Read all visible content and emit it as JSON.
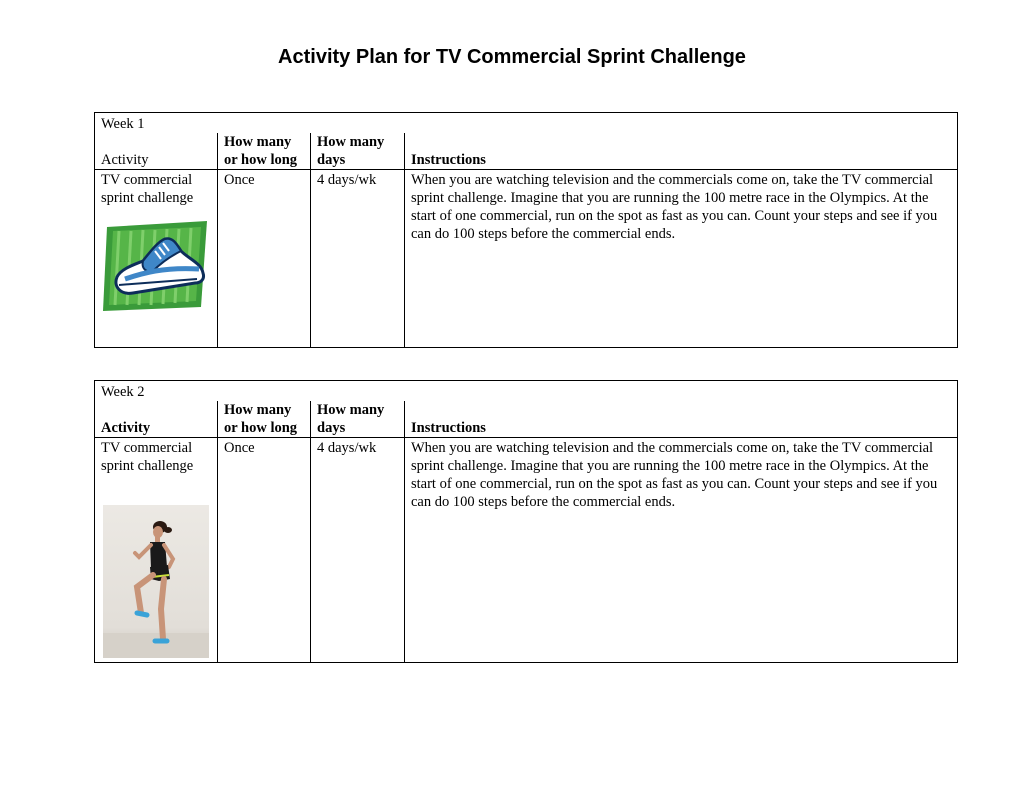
{
  "title": "Activity Plan for TV Commercial Sprint Challenge",
  "weeks": [
    {
      "label": "Week 1",
      "headers": {
        "activity": "Activity",
        "how_many_line1": "How many",
        "how_many_line2": "or how long",
        "days_line1": "How many",
        "days_line2": "days",
        "instructions": "Instructions"
      },
      "row": {
        "activity": "TV commercial sprint challenge",
        "how_many": "Once",
        "days": "4 days/wk",
        "instructions": "When you are watching television and the commercials come on, take the TV commercial sprint challenge. Imagine that you are running the 100 metre race in the Olympics. At the start of one commercial, run on the spot as fast as you can. Count your steps and see if you can do 100 steps before the commercial ends."
      }
    },
    {
      "label": "Week 2",
      "headers": {
        "activity": "Activity",
        "how_many_line1": "How many",
        "how_many_line2": "or how long",
        "days_line1": "How many",
        "days_line2": "days",
        "instructions": "Instructions"
      },
      "row": {
        "activity": "TV commercial sprint challenge",
        "how_many": "Once",
        "days": "4 days/wk",
        "instructions": "When you are watching television and the commercials come on, take the TV commercial sprint challenge. Imagine that you are running the 100 metre race in the Olympics. At the start of one commercial, run on the spot as fast as you can. Count your steps and see if you can do 100 steps before the commercial ends."
      }
    }
  ],
  "colors": {
    "shoe_background": "#3a9b3a",
    "shoe_blue": "#3f87c8",
    "photo_background": "#e6e3de"
  },
  "icons": [
    "running-shoe-icon",
    "woman-running-in-place-photo"
  ]
}
